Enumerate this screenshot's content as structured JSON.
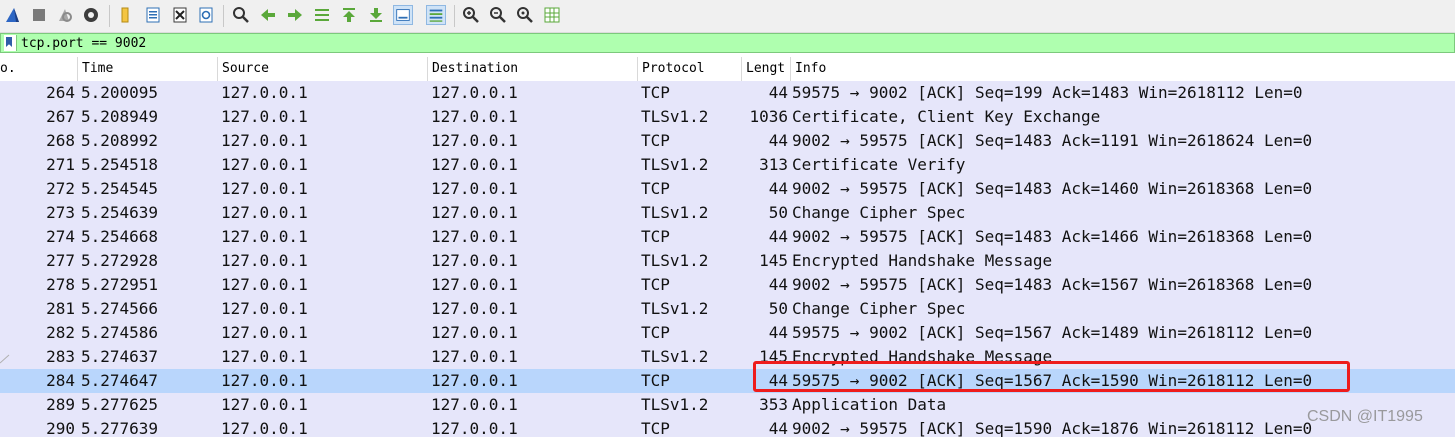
{
  "toolbar": {
    "buttons": [
      {
        "name": "start-capture-icon"
      },
      {
        "name": "stop-capture-icon"
      },
      {
        "name": "restart-capture-icon"
      },
      {
        "name": "capture-options-icon"
      },
      {
        "name": "open-file-icon"
      },
      {
        "name": "save-file-icon"
      },
      {
        "name": "close-file-icon"
      },
      {
        "name": "reload-file-icon"
      },
      {
        "name": "find-packet-icon"
      },
      {
        "name": "go-back-icon"
      },
      {
        "name": "go-forward-icon"
      },
      {
        "name": "go-to-packet-icon"
      },
      {
        "name": "first-packet-icon"
      },
      {
        "name": "last-packet-icon"
      },
      {
        "name": "autoscroll-icon"
      },
      {
        "name": "colorize-icon"
      },
      {
        "name": "zoom-in-icon"
      },
      {
        "name": "zoom-out-icon"
      },
      {
        "name": "normal-size-icon"
      },
      {
        "name": "resize-columns-icon"
      }
    ]
  },
  "filter": {
    "value": "tcp.port == 9002"
  },
  "columns": {
    "no": "o.",
    "time": "Time",
    "source": "Source",
    "destination": "Destination",
    "protocol": "Protocol",
    "length": "Lengt",
    "info": "Info"
  },
  "packets": [
    {
      "no": "264",
      "time": "5.200095",
      "src": "127.0.0.1",
      "dst": "127.0.0.1",
      "proto": "TCP",
      "len": "44",
      "info": "59575 → 9002 [ACK] Seq=199 Ack=1483 Win=2618112 Len=0"
    },
    {
      "no": "267",
      "time": "5.208949",
      "src": "127.0.0.1",
      "dst": "127.0.0.1",
      "proto": "TLSv1.2",
      "len": "1036",
      "info": "Certificate, Client Key Exchange"
    },
    {
      "no": "268",
      "time": "5.208992",
      "src": "127.0.0.1",
      "dst": "127.0.0.1",
      "proto": "TCP",
      "len": "44",
      "info": "9002 → 59575 [ACK] Seq=1483 Ack=1191 Win=2618624 Len=0"
    },
    {
      "no": "271",
      "time": "5.254518",
      "src": "127.0.0.1",
      "dst": "127.0.0.1",
      "proto": "TLSv1.2",
      "len": "313",
      "info": "Certificate Verify"
    },
    {
      "no": "272",
      "time": "5.254545",
      "src": "127.0.0.1",
      "dst": "127.0.0.1",
      "proto": "TCP",
      "len": "44",
      "info": "9002 → 59575 [ACK] Seq=1483 Ack=1460 Win=2618368 Len=0"
    },
    {
      "no": "273",
      "time": "5.254639",
      "src": "127.0.0.1",
      "dst": "127.0.0.1",
      "proto": "TLSv1.2",
      "len": "50",
      "info": "Change Cipher Spec"
    },
    {
      "no": "274",
      "time": "5.254668",
      "src": "127.0.0.1",
      "dst": "127.0.0.1",
      "proto": "TCP",
      "len": "44",
      "info": "9002 → 59575 [ACK] Seq=1483 Ack=1466 Win=2618368 Len=0"
    },
    {
      "no": "277",
      "time": "5.272928",
      "src": "127.0.0.1",
      "dst": "127.0.0.1",
      "proto": "TLSv1.2",
      "len": "145",
      "info": "Encrypted Handshake Message"
    },
    {
      "no": "278",
      "time": "5.272951",
      "src": "127.0.0.1",
      "dst": "127.0.0.1",
      "proto": "TCP",
      "len": "44",
      "info": "9002 → 59575 [ACK] Seq=1483 Ack=1567 Win=2618368 Len=0"
    },
    {
      "no": "281",
      "time": "5.274566",
      "src": "127.0.0.1",
      "dst": "127.0.0.1",
      "proto": "TLSv1.2",
      "len": "50",
      "info": "Change Cipher Spec"
    },
    {
      "no": "282",
      "time": "5.274586",
      "src": "127.0.0.1",
      "dst": "127.0.0.1",
      "proto": "TCP",
      "len": "44",
      "info": "59575 → 9002 [ACK] Seq=1567 Ack=1489 Win=2618112 Len=0"
    },
    {
      "no": "283",
      "time": "5.274637",
      "src": "127.0.0.1",
      "dst": "127.0.0.1",
      "proto": "TLSv1.2",
      "len": "145",
      "info": "Encrypted Handshake Message"
    },
    {
      "no": "284",
      "time": "5.274647",
      "src": "127.0.0.1",
      "dst": "127.0.0.1",
      "proto": "TCP",
      "len": "44",
      "info": "59575 → 9002 [ACK] Seq=1567 Ack=1590 Win=2618112 Len=0",
      "selected": true
    },
    {
      "no": "289",
      "time": "5.277625",
      "src": "127.0.0.1",
      "dst": "127.0.0.1",
      "proto": "TLSv1.2",
      "len": "353",
      "info": "Application Data"
    },
    {
      "no": "290",
      "time": "5.277639",
      "src": "127.0.0.1",
      "dst": "127.0.0.1",
      "proto": "TCP",
      "len": "44",
      "info": "9002 → 59575 [ACK] Seq=1590 Ack=1876 Win=2618112 Len=0"
    }
  ],
  "colors": {
    "row_bg": "#e6e6fa",
    "selected_bg": "#b9d6fc",
    "filter_bg": "#afffaf",
    "annotation_red": "#ee1c1c"
  },
  "watermark": "CSDN @IT1995"
}
